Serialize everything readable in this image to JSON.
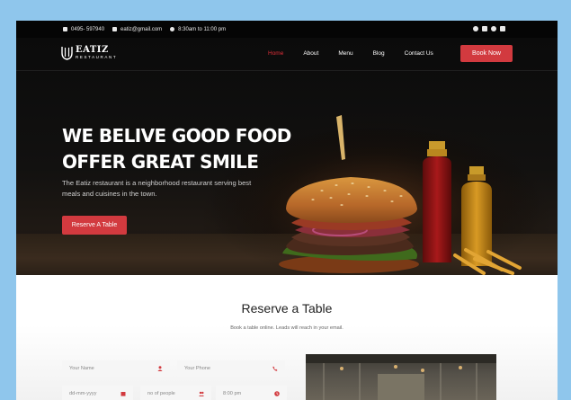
{
  "topbar": {
    "phone": "0495- 597940",
    "email": "eatiz@gmail.com",
    "hours": "8:30am to 11:00 pm",
    "social_icons": [
      "facebook-icon",
      "instagram-icon",
      "twitter-icon",
      "youtube-icon"
    ]
  },
  "brand": {
    "name": "EATIZ",
    "subtitle": "RESTAURANT"
  },
  "nav": {
    "items": [
      {
        "label": "Home",
        "active": true
      },
      {
        "label": "About",
        "active": false
      },
      {
        "label": "Menu",
        "active": false
      },
      {
        "label": "Blog",
        "active": false
      },
      {
        "label": "Contact Us",
        "active": false
      }
    ],
    "book_label": "Book Now"
  },
  "hero": {
    "headline_line1": "WE BELIVE GOOD FOOD",
    "headline_line2": "OFFER GREAT SMILE",
    "tagline": "The Eatiz restaurant is a neighborhood restaurant serving best meals and cuisines in the town.",
    "cta_label": "Reserve A Table"
  },
  "reserve": {
    "title": "Reserve a Table",
    "subtitle": "Book a table online. Leads will reach in your email.",
    "name_placeholder": "Your Name",
    "phone_placeholder": "Your Phone",
    "date_placeholder": "dd-mm-yyyy",
    "people_placeholder": "no of people",
    "time_placeholder": "8:00 pm"
  },
  "colors": {
    "accent": "#d23a3f",
    "background": "#8fc6ec",
    "topbar": "#050505"
  }
}
